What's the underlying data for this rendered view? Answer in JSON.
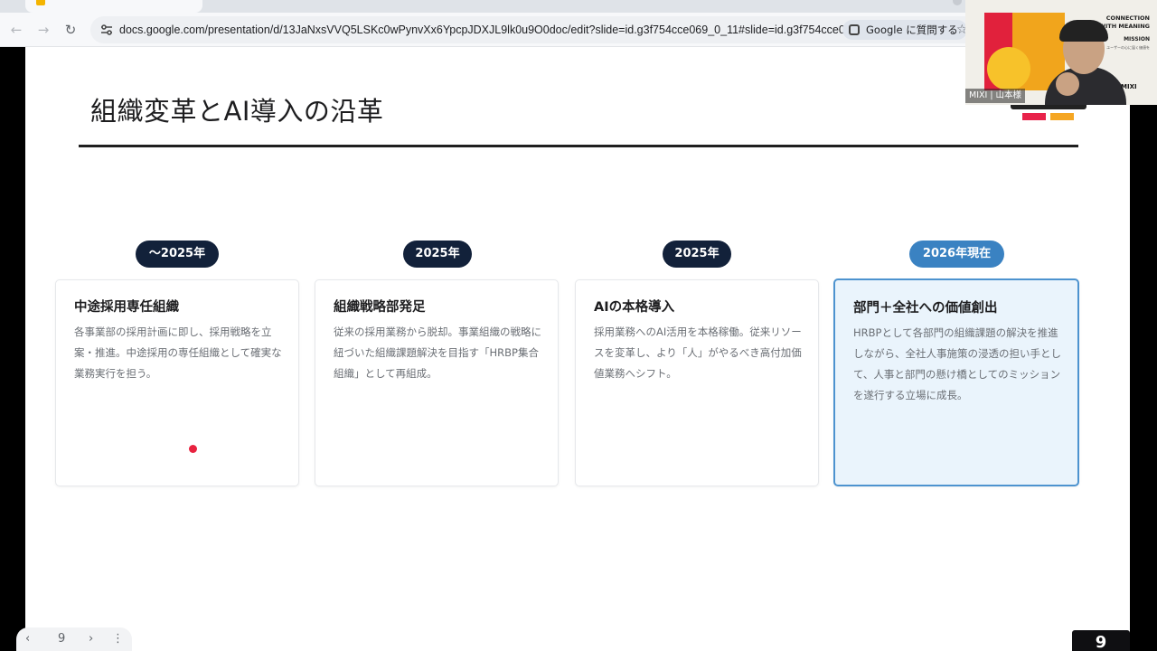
{
  "browser": {
    "url": "docs.google.com/presentation/d/13JaNxsVVQ5LSKc0wPynvXx6YpcpJDXJL9lk0u9O0doc/edit?slide=id.g3f754cce069_0_11#slide=id.g3f754cce069_0_11",
    "ask_google_label": "Google に質問する",
    "back_glyph": "←",
    "forward_glyph": "→",
    "reload_glyph": "↻",
    "star_glyph": "☆"
  },
  "slide": {
    "title": "組織変革とAI導入の沿革",
    "milestones": [
      {
        "period": "～2025年",
        "title": "中途採用専任組織",
        "text": "各事業部の採用計画に即し、採用戦略を立案・推進。中途採用の専任組織として確実な業務実行を担う。",
        "current": false
      },
      {
        "period": "2025年",
        "title": "組織戦略部発足",
        "text": "従来の採用業務から脱却。事業組織の戦略に紐づいた組織課題解決を目指す「HRBP集合組織」として再組成。",
        "current": false
      },
      {
        "period": "2025年",
        "title": "AIの本格導入",
        "text": "採用業務へのAI活用を本格稼働。従来リソースを変革し、より「人」がやるべき高付加価値業務へシフト。",
        "current": false
      },
      {
        "period": "2026年現在",
        "title": "部門＋全社への価値創出",
        "text": "HRBPとして各部門の組織課題の解決を推進しながら、全社人事施策の浸透の担い手として、人事と部門の懸け橋としてのミッションを遂行する立場に成長。",
        "current": true
      }
    ]
  },
  "slide_nav": {
    "prev_glyph": "‹",
    "page": "9",
    "next_glyph": "›",
    "more_glyph": "⋮"
  },
  "corner_badge": "9",
  "video": {
    "brand_lines": [
      "CONNECTION",
      "WITH MEANING"
    ],
    "mission": "MISSION",
    "tagline": "ユーザーの心に届く価値を",
    "logo": "MIXI",
    "participant": "MIXI | 山本様"
  },
  "colors": {
    "pill_dark": "#12213a",
    "pill_current": "#3a82c2",
    "card_current_bg": "#eaf4fc",
    "card_current_border": "#4d93cf",
    "laser_pointer": "#e8223f"
  }
}
